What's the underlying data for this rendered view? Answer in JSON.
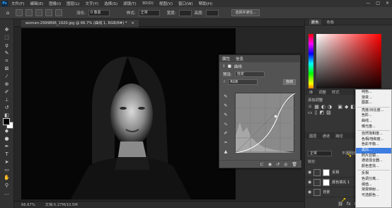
{
  "menubar": {
    "logo": "Ps",
    "items": [
      "文件(F)",
      "编辑(E)",
      "图像(I)",
      "图层(L)",
      "文字(Y)",
      "选择(S)",
      "滤镜(T)",
      "3D(D)",
      "视图(V)",
      "窗口(W)",
      "帮助(H)"
    ],
    "window_controls": [
      "—",
      "□",
      "✕"
    ]
  },
  "options_bar": {
    "feather_label": "羽化:",
    "feather_value": "0 像素",
    "style_label": "样式:",
    "style_value": "正常",
    "width_label": "宽度:",
    "height_label": "高度:",
    "select_mask_button": "选择并遮住..."
  },
  "document": {
    "tab_title": "woman-2999896_1920.jpg @ 66.7% (曲线 1, RGB/8#) *",
    "close_glyph": "×"
  },
  "status": {
    "zoom": "66.67%",
    "doc_info": "文档:5.27M/10.5M"
  },
  "properties_panel": {
    "tabs": [
      "属性",
      "信息"
    ],
    "adj_title": "曲线",
    "preset_label": "预设:",
    "preset_value": "自定",
    "channel_value": "RGB",
    "auto_button": "自动"
  },
  "right_panels": {
    "color_tabs": [
      "颜色",
      "色板"
    ],
    "adjust_tabs": [
      "库",
      "调整",
      "样式"
    ],
    "adjust_subtitle": "添加调整",
    "layer_tabs": [
      "图层",
      "通道",
      "路径"
    ],
    "blend_mode": "正常",
    "opacity_label": "不透明度:",
    "lock_label": "锁定:",
    "layers": [
      {
        "name": "反相"
      },
      {
        "name": "颜色填充 1"
      },
      {
        "name": "背景"
      }
    ]
  },
  "context_menu": {
    "items": [
      "纯色...",
      "渐变...",
      "图案...",
      "---",
      "亮度/对比度...",
      "色阶...",
      "曲线...",
      "曝光度...",
      "---",
      "自然饱和度...",
      "色相/饱和度...",
      "色彩平衡...",
      "黑白...",
      "照片滤镜...",
      "通道混合器...",
      "颜色查找...",
      "---",
      "反相",
      "色调分离...",
      "阈值...",
      "渐变映射...",
      "可选颜色..."
    ],
    "selected": "黑白..."
  },
  "colors": {
    "accent": "#3d7ee0",
    "highlight_arrow": "#f5d000"
  }
}
